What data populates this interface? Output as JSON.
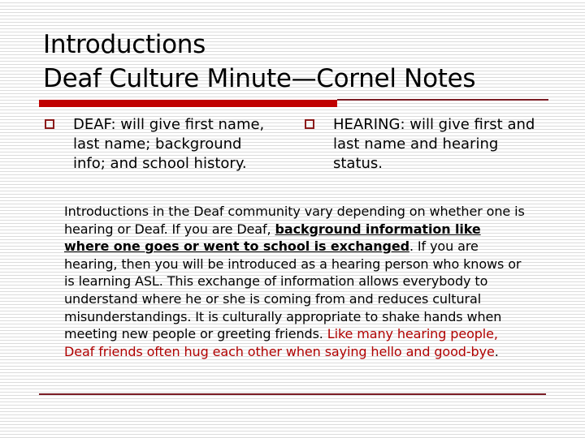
{
  "slide": {
    "title_line1": "Introductions",
    "title_line2": "Deaf Culture Minute—Cornel Notes",
    "accent_color": "#c00000",
    "bullets": [
      {
        "icon": "hollow-square-bullet",
        "text": "DEAF: will give first name, last name; background info; and school history."
      },
      {
        "icon": "hollow-square-bullet",
        "text": "HEARING: will give first and last name and hearing status."
      }
    ],
    "body": {
      "part1": "Introductions in the Deaf community vary depending on whether one is hearing or Deaf. If you are Deaf, ",
      "emphasis": "background information like where one goes or went to school is exchanged",
      "part2": ". If you are hearing, then you will be introduced as a hearing person who knows or is learning ASL. This exchange of information allows everybody to understand where he or she is coming from and reduces cultural misunderstandings. It is culturally appropriate to shake hands when meeting new people or greeting friends. ",
      "red_text": "Like many hearing people, Deaf friends often hug each other when saying hello and good-bye",
      "end": "."
    }
  }
}
